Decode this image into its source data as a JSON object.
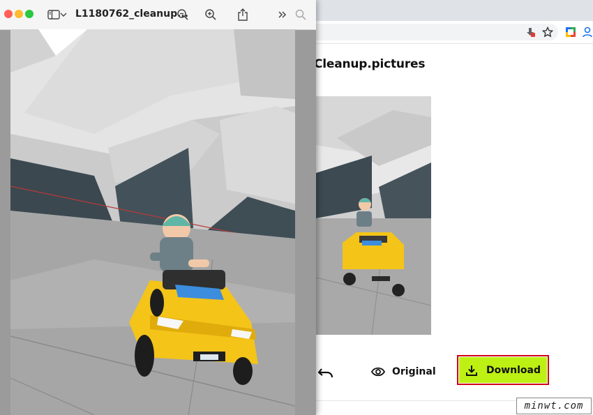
{
  "preview_window": {
    "title": "L1180762_cleanup...",
    "toolbar_icons": [
      "sidebar-icon",
      "chevron-down-icon",
      "zoom-out-icon",
      "zoom-in-icon",
      "share-icon",
      "more-chevrons-icon",
      "search-icon"
    ]
  },
  "browser": {
    "toolbar_icons": [
      "extension-icon",
      "bookmark-star-icon",
      "google-app-icon",
      "profile-icon"
    ],
    "site_title": "Cleanup.pictures",
    "actions": {
      "original_label": "Original",
      "download_label": "Download"
    }
  },
  "watermark": {
    "text": "minwt.com"
  },
  "colors": {
    "download_bg": "#bdf013",
    "highlight_outline": "#d0021b",
    "car_yellow": "#f4c419",
    "close_light": "#ff5f57",
    "minimize_light": "#febc2e",
    "zoom_light": "#28c840"
  }
}
